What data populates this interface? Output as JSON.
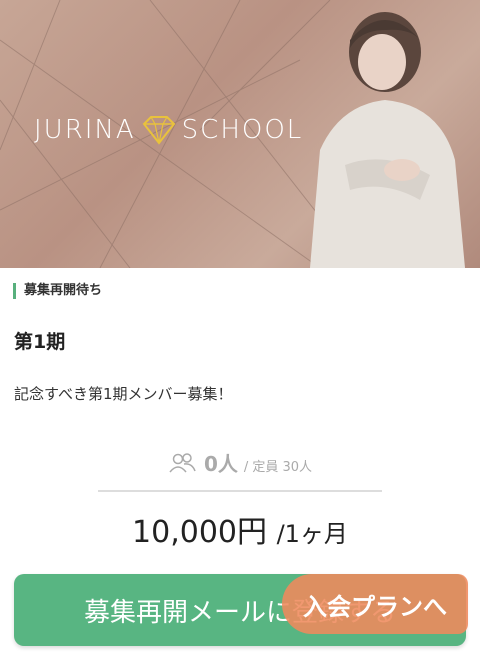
{
  "hero": {
    "logo_left": "JURINA",
    "logo_right": "SCHOOL"
  },
  "course": {
    "status": "募集再開待ち",
    "term": "第1期",
    "description": "記念すべき第1期メンバー募集！",
    "members_count": "0人",
    "capacity": "/ 定員 30人",
    "price": "10,000円",
    "price_unit": "/1ヶ月"
  },
  "actions": {
    "register_label": "募集再開メールに登録する",
    "join_plan_label": "入会プランへ"
  },
  "colors": {
    "accent_green": "#58b582",
    "accent_orange": "#ef8a5c"
  }
}
